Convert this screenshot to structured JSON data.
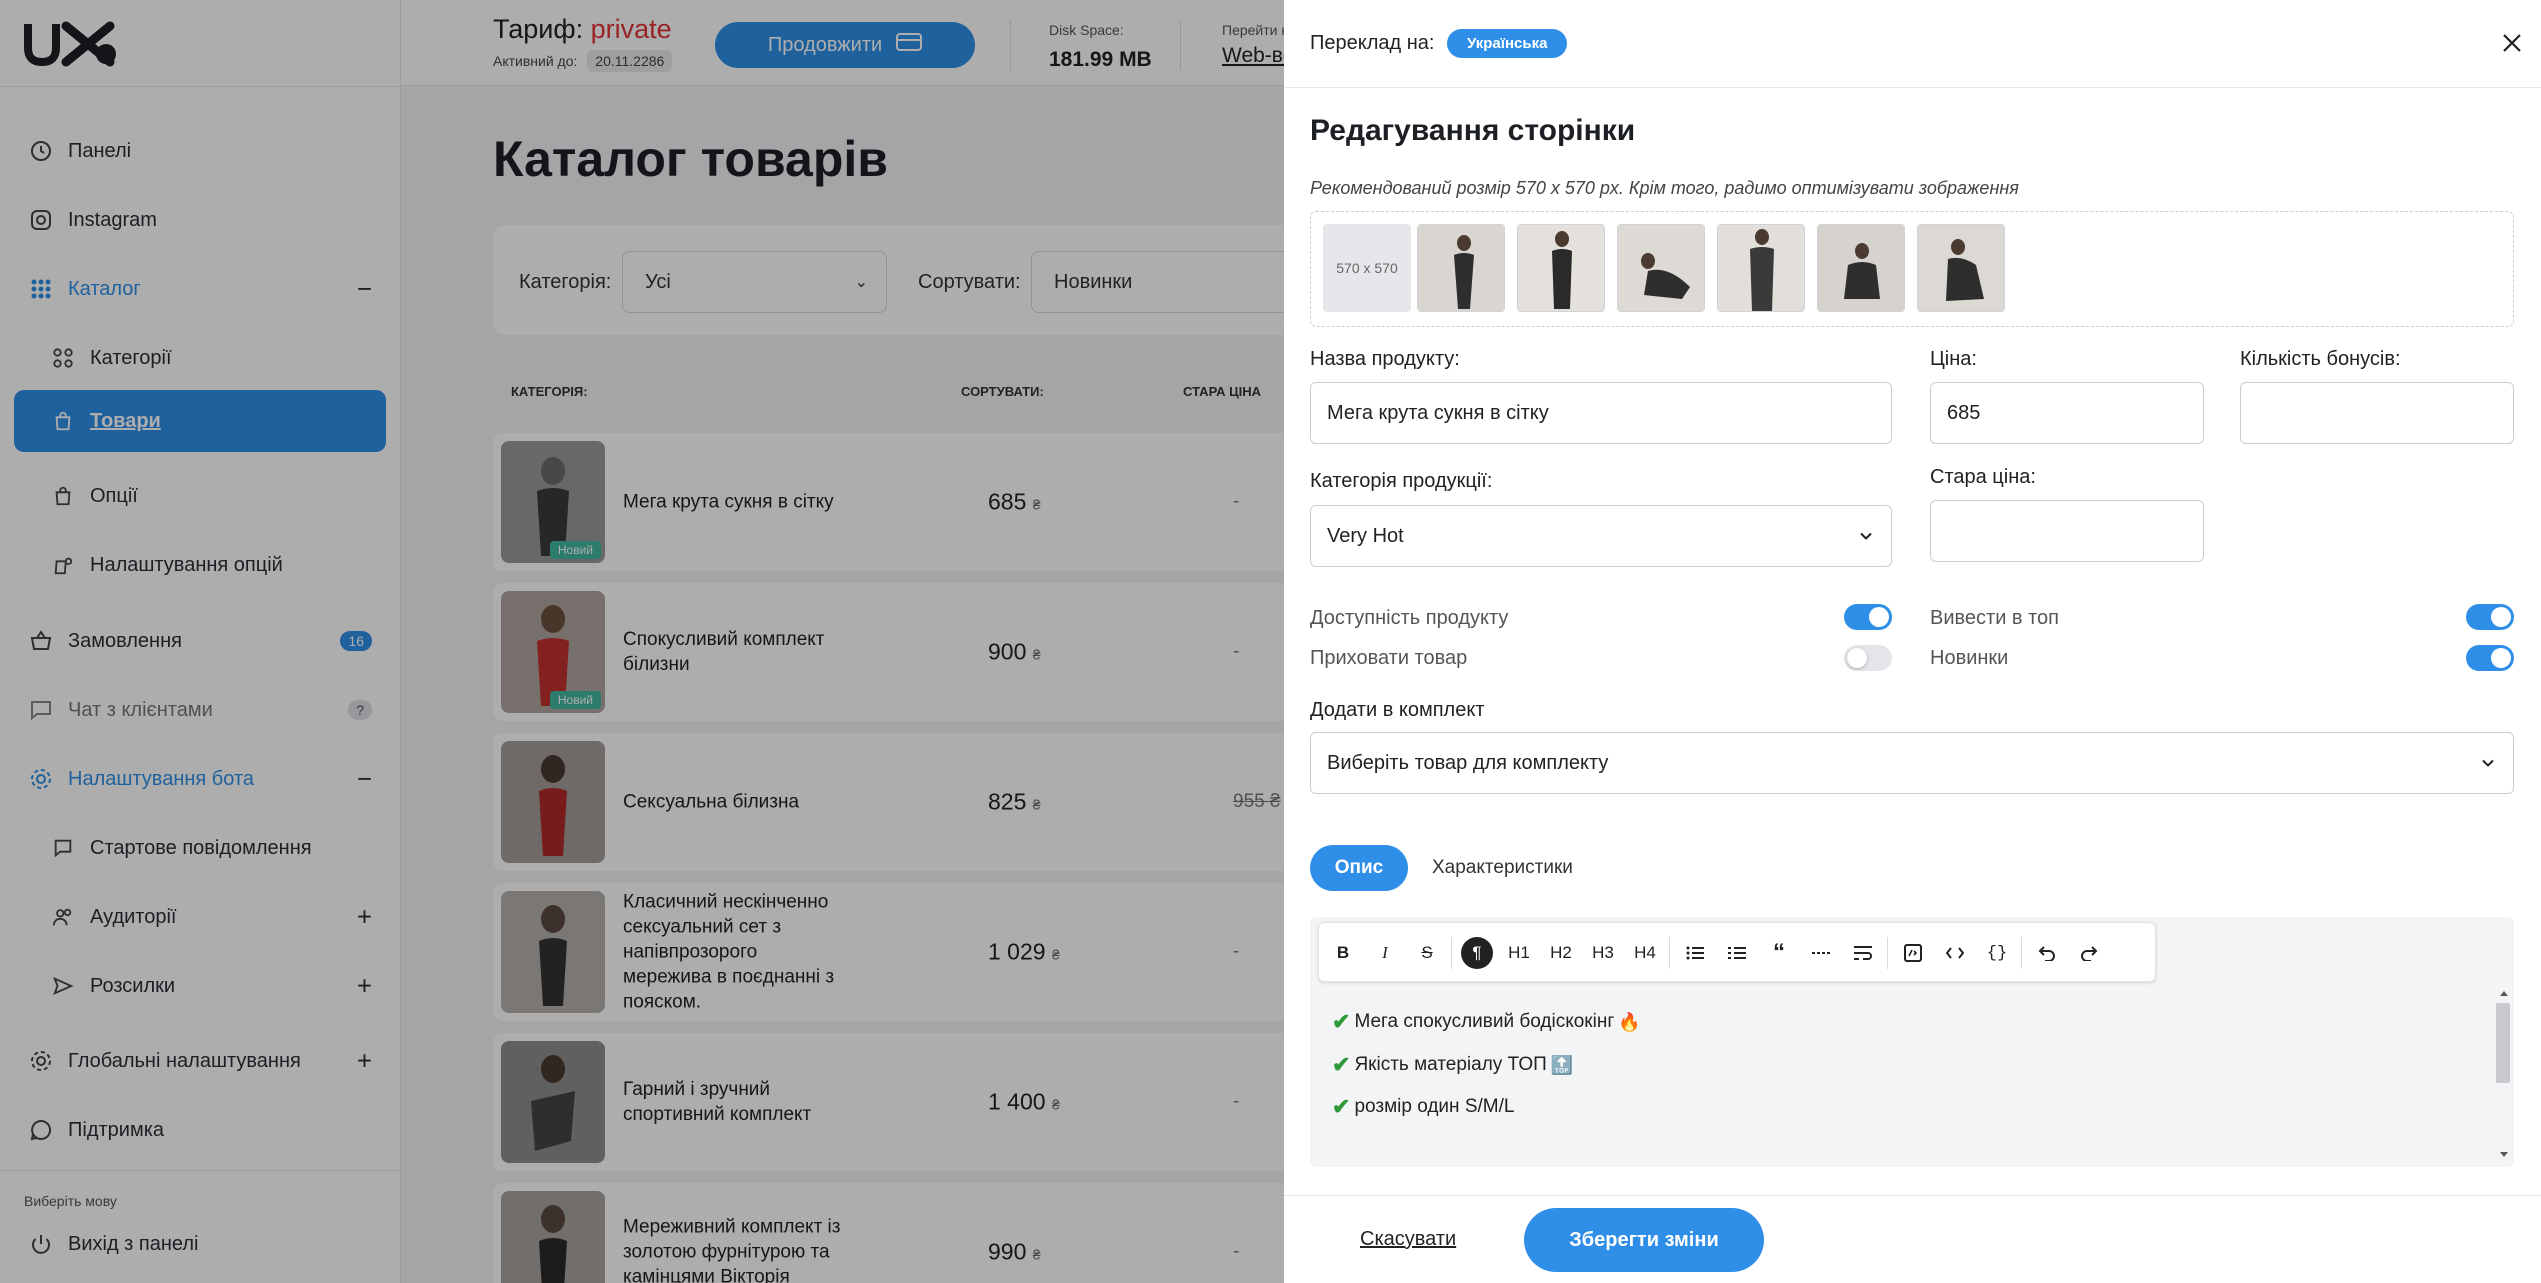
{
  "sidebar": {
    "logo": "UX",
    "items": [
      {
        "label": "Панелі",
        "icon": "clock-icon"
      },
      {
        "label": "Instagram",
        "icon": "instagram-icon"
      },
      {
        "label": "Каталог",
        "icon": "grid-icon"
      },
      {
        "label": "Категорії",
        "icon": "categories-icon"
      },
      {
        "label": "Товари",
        "icon": "bag-icon"
      },
      {
        "label": "Опції",
        "icon": "option-icon"
      },
      {
        "label": "Налаштування опцій",
        "icon": "option-settings-icon"
      },
      {
        "label": "Замовлення",
        "icon": "basket-icon",
        "badge": "16"
      },
      {
        "label": "Чат з клієнтами",
        "icon": "chat-icon",
        "badge": "?"
      },
      {
        "label": "Налаштування бота",
        "icon": "gear-icon"
      },
      {
        "label": "Стартове повідомлення",
        "icon": "message-icon"
      },
      {
        "label": "Аудиторії",
        "icon": "people-icon"
      },
      {
        "label": "Розсилки",
        "icon": "send-icon"
      },
      {
        "label": "Глобальні налаштування",
        "icon": "gear-icon"
      },
      {
        "label": "Підтримка",
        "icon": "support-icon"
      }
    ],
    "language_hint": "Виберіть мову",
    "logout": "Вихід з панелі"
  },
  "topbar": {
    "plan_label": "Тариф:",
    "plan_value": "private",
    "active_until_label": "Активний до:",
    "active_until": "20.11.2286",
    "renew_button": "Продовжити",
    "disk_label": "Disk Space:",
    "disk_value": "181.99 MB",
    "goto_label": "Перейти к",
    "goto_link": "Web-ве"
  },
  "catalog": {
    "title": "Каталог товарів",
    "filter_category_label": "Категорія:",
    "filter_category_value": "Усі",
    "sort_label": "Сортувати:",
    "sort_value": "Новинки",
    "columns": [
      "КАТЕГОРІЯ:",
      "СОРТУВАТИ:",
      "СТАРА ЦІНА"
    ],
    "currency": "₴",
    "new_badge": "Новий",
    "rows": [
      {
        "name": "Мега крута сукня в сітку",
        "price": "685",
        "old": "-",
        "new": true
      },
      {
        "name": "Спокусливий комплект білизни",
        "price": "900",
        "old": "-",
        "new": true
      },
      {
        "name": "Сексуальна білизна",
        "price": "825",
        "old": "955 ₴",
        "new": false
      },
      {
        "name": "Класичний нескінченно сексуальний сет з напівпрозорого мереживa в поєднанні з пояском.",
        "price": "1 029",
        "old": "-",
        "new": false
      },
      {
        "name": "Гарний і зручний спортивний комплект",
        "price": "1 400",
        "old": "-",
        "new": false
      },
      {
        "name": "Мереживний комплект із золотою фурнітурою та камінцями Вікторія",
        "price": "990",
        "old": "-",
        "new": false
      }
    ]
  },
  "drawer": {
    "translate_label": "Переклад на:",
    "language": "Українська",
    "title": "Редагування сторінки",
    "image_hint": "Рекомендований розмір 570 x 570 px. Крім того, радимо оптимізувати зображення",
    "placeholder_size": "570 x 570",
    "fields": {
      "name_label": "Назва продукту:",
      "name_value": "Мега крута сукня в сітку",
      "price_label": "Ціна:",
      "price_value": "685",
      "bonus_label": "Кількість бонусів:",
      "bonus_value": "",
      "category_label": "Категорія продукції:",
      "category_value": "Very Hot",
      "old_price_label": "Стара ціна:",
      "old_price_value": ""
    },
    "toggles": {
      "available_label": "Доступність продукту",
      "available": true,
      "top_label": "Вивести в топ",
      "top": true,
      "hide_label": "Приховати товар",
      "hide": false,
      "new_label": "Новинки",
      "new": true
    },
    "bundle_label": "Додати в комплект",
    "bundle_placeholder": "Виберіть товар для комплекту",
    "tabs": [
      "Опис",
      "Характеристики"
    ],
    "toolbar": [
      "B",
      "I",
      "S",
      "¶",
      "H1",
      "H2",
      "H3",
      "H4"
    ],
    "description_lines": [
      {
        "text": "Мега спокусливий бодіскокінг",
        "emoji": "🔥"
      },
      {
        "text": "Якість матеріалу ТОП",
        "emoji": "🔝"
      },
      {
        "text": "розмір один S/M/L",
        "emoji": ""
      }
    ],
    "cancel": "Скасувати",
    "save": "Зберегти зміни"
  },
  "colors": {
    "accent": "#2f8fe8",
    "plan_value": "#e2343a",
    "new_badge": "#41b7a0",
    "check": "#2e9a3a"
  }
}
